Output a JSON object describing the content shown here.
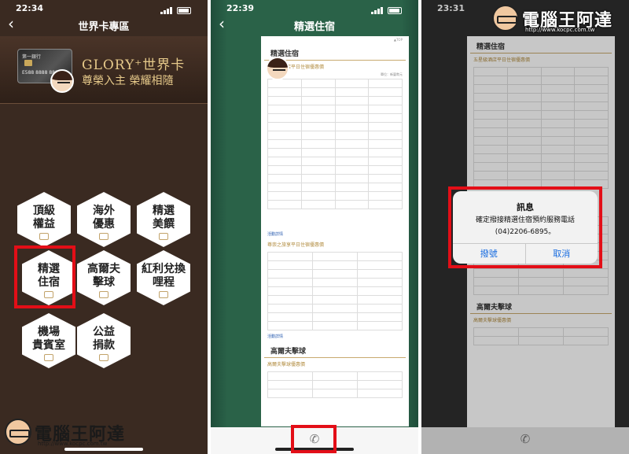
{
  "phones": [
    {
      "time": "22:34",
      "title": "世界卡專區",
      "banner": {
        "card_bank": "第一銀行",
        "card_number": "E588 8888 8888",
        "brand": "GLORY⁺世界卡",
        "slogan": "尊榮入主 榮耀相隨"
      },
      "menu": [
        {
          "label": "頂級\n權益",
          "icon": "diamond-icon"
        },
        {
          "label": "海外\n優惠",
          "icon": "plane-icon"
        },
        {
          "label": "精選\n美饌",
          "icon": "dish-icon"
        },
        {
          "label": "精選\n住宿",
          "icon": "bed-icon"
        },
        {
          "label": "高爾夫\n擊球",
          "icon": "golf-icon"
        },
        {
          "label": "紅利兌換\n哩程",
          "icon": "gift-icon"
        },
        {
          "label": "機場\n貴賓室",
          "icon": "suitcase-icon"
        },
        {
          "label": "公益\n捐款",
          "icon": "heart-icon"
        }
      ]
    },
    {
      "time": "22:39",
      "title": "精選住宿",
      "doc": {
        "heading": "精選住宿",
        "section1": "五星級酒店平日住宿優惠價",
        "unit": "單位：新臺幣元",
        "section2": "尊崇之旅享平日住宿優惠價",
        "section3": "高爾夫擊球",
        "section3_sub": "高爾夫擊球優惠價",
        "link": "活動詳情",
        "top": "▲TOP"
      }
    },
    {
      "time": "23:31",
      "alert": {
        "title": "訊息",
        "message": "確定撥接精選住宿預約服務電話",
        "phone": "(04)2206-6895。",
        "confirm": "撥號",
        "cancel": "取消"
      }
    }
  ],
  "watermark": {
    "name": "電腦王阿達",
    "url": "http://www.kocpc.com.tw"
  },
  "colors": {
    "highlight": "#e30e17",
    "gold": "#c8a96e",
    "ios_blue": "#1a6de0"
  }
}
